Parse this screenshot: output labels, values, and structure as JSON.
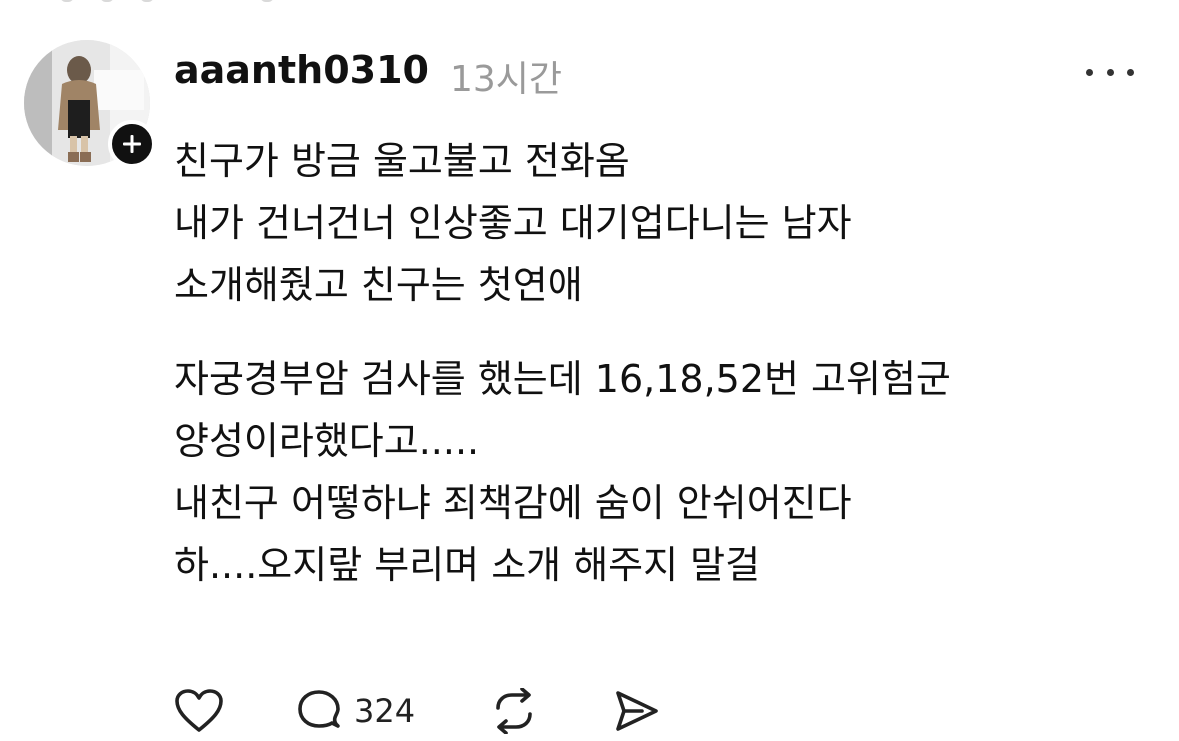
{
  "post": {
    "username": "aaanth0310",
    "timestamp": "13시간",
    "lines_group1": [
      "친구가 방금 울고불고 전화옴",
      "내가 건너건너 인상좋고 대기업다니는 남자",
      "소개해줬고 친구는 첫연애"
    ],
    "lines_group2": [
      "자궁경부암 검사를 했는데 16,18,52번 고위험군",
      "양성이라했다고.....",
      "내친구 어떻하냐 죄책감에 숨이 안쉬어진다",
      "하....오지랖 부리며 소개 해주지 말걸"
    ]
  },
  "actions": {
    "reply_count": "324"
  },
  "icons": {
    "follow": "plus-icon",
    "more": "more-dots-icon",
    "like": "heart-icon",
    "reply": "speech-bubble-icon",
    "repost": "repost-icon",
    "share": "send-icon"
  }
}
